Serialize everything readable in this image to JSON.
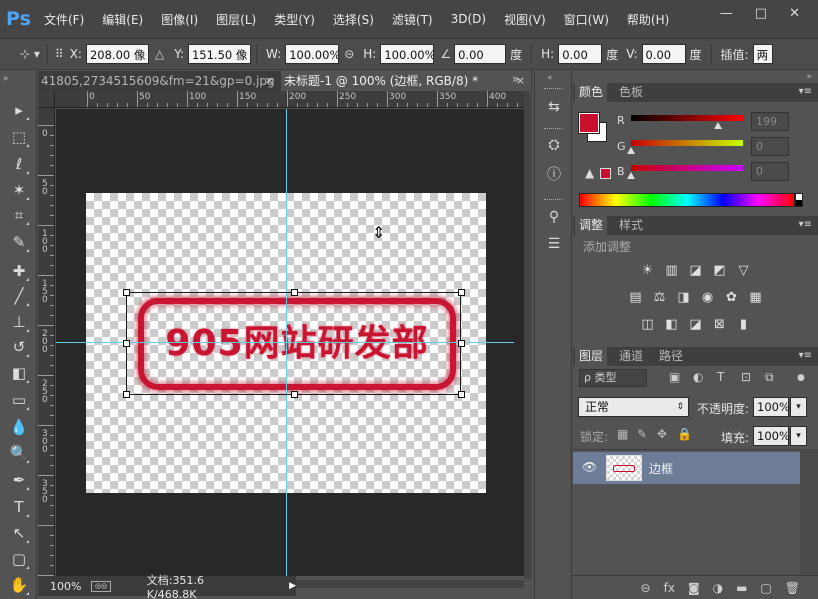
{
  "app": {
    "logo": "Ps",
    "menu": [
      "文件(F)",
      "编辑(E)",
      "图像(I)",
      "图层(L)",
      "类型(Y)",
      "选择(S)",
      "滤镜(T)",
      "3D(D)",
      "视图(V)",
      "窗口(W)",
      "帮助(H)"
    ],
    "window_controls": [
      "—",
      "□",
      "✕"
    ]
  },
  "options": {
    "x_label": "X:",
    "x_value": "208.00 像",
    "y_label": "Y:",
    "y_value": "151.50 像",
    "w_label": "W:",
    "w_value": "100.00%",
    "h_label": "H:",
    "h_value": "100.00%",
    "angle_value": "0.00",
    "angle_unit": "度",
    "hskew_label": "H:",
    "hskew_value": "0.00",
    "hskew_unit": "度",
    "vskew_label": "V:",
    "vskew_value": "0.00",
    "vskew_unit": "度",
    "interp_label": "插值:",
    "interp_value": "两"
  },
  "tabs": {
    "tab1_label": "41805,2734515609&fm=21&gp=0.jpg",
    "tab1_close": "×",
    "tab2_label": "未标题-1 @ 100% (边框, RGB/8) *",
    "tab2_close": "×",
    "expand": "»"
  },
  "ruler": {
    "h_labels": [
      "0",
      "50",
      "100",
      "150",
      "200",
      "250",
      "300",
      "350",
      "400"
    ],
    "v_labels": [
      "0",
      "5 0",
      "1 0 0",
      "1 5 0",
      "2 0 0",
      "2 5 0",
      "3 0 0",
      "3 5 0"
    ]
  },
  "canvas": {
    "stamp_text": "905网站研发部"
  },
  "status": {
    "zoom": "100%",
    "doc_info": "文档:351.6 K/468.8K",
    "arrow": "▶"
  },
  "color_panel": {
    "tab_active": "颜色",
    "tab_other": "色板",
    "r_label": "R",
    "r_value": "199",
    "g_label": "G",
    "g_value": "0",
    "b_label": "B",
    "b_value": "0",
    "fg_color": "#c8102e"
  },
  "adjust_panel": {
    "tab_active": "调整",
    "tab_other": "样式",
    "title": "添加调整"
  },
  "layers_panel": {
    "tab_active": "图层",
    "tab_channels": "通道",
    "tab_paths": "路径",
    "search_placeholder": "ρ 类型",
    "blend_mode": "正常",
    "opacity_label": "不透明度:",
    "opacity_value": "100%",
    "lock_label": "锁定:",
    "fill_label": "填充:",
    "fill_value": "100%",
    "layers": [
      {
        "name": "边框"
      }
    ]
  },
  "colors": {
    "accent": "#c81532",
    "guide": "#5fd0e6",
    "selected_layer": "#6d7d97"
  }
}
